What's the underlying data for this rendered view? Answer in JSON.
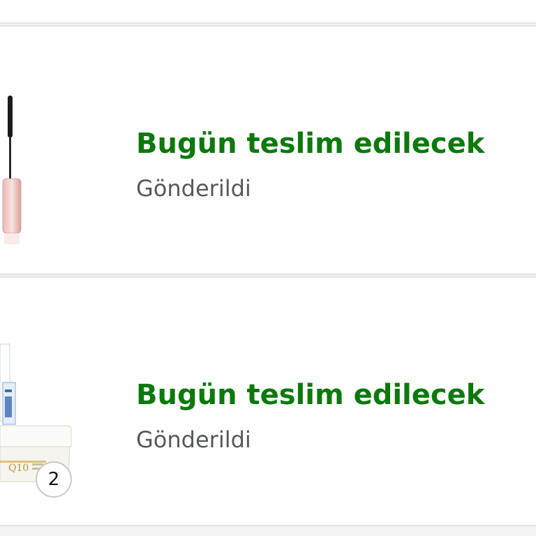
{
  "orders": [
    {
      "status": "Bugün teslim edilecek",
      "substatus": "Gönderildi",
      "image_icon": "mascara-icon"
    },
    {
      "status": "Bugün teslim edilecek",
      "substatus": "Gönderildi",
      "image_icon": "cream-jar-icon",
      "image_label": "Q10",
      "quantity": "2"
    }
  ],
  "colors": {
    "status_green": "#0b7a0b",
    "substatus_gray": "#565959",
    "divider": "#e3e3e3"
  }
}
